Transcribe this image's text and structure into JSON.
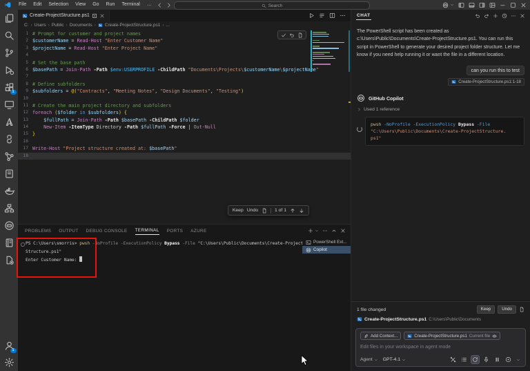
{
  "window": {
    "menus": [
      "File",
      "Edit",
      "Selection",
      "View",
      "Go",
      "Run",
      "Terminal"
    ],
    "menu_overflow": "…",
    "nav_icons": [
      "arrow-left",
      "arrow-right"
    ],
    "search_placeholder": "Search",
    "right_icons": [
      "copilot",
      "chevron-down",
      "layout-sidebar-left",
      "layout-panel",
      "layout-sidebar-right",
      "layout-custom",
      "minimize",
      "maximize",
      "close"
    ]
  },
  "activity_bar": {
    "items": [
      {
        "name": "explorer"
      },
      {
        "name": "search"
      },
      {
        "name": "source-control"
      },
      {
        "name": "run-and-debug"
      },
      {
        "name": "extensions",
        "badge": "1"
      },
      {
        "name": "remote-explorer"
      },
      {
        "name": "azure"
      },
      {
        "name": "python"
      },
      {
        "name": "share"
      },
      {
        "name": "notebook-edit"
      },
      {
        "name": "docker"
      },
      {
        "name": "hierarchy"
      },
      {
        "name": "copilot"
      },
      {
        "name": "notebook"
      },
      {
        "name": "file-settings"
      }
    ],
    "bottom": [
      {
        "name": "accounts",
        "badge": "1"
      },
      {
        "name": "settings"
      }
    ]
  },
  "editor": {
    "tab": {
      "label": "Create-ProjectStructure.ps1"
    },
    "actions": [
      "play",
      "run-menu",
      "split-editor",
      "more"
    ],
    "breadcrumb": [
      "C:",
      "Users",
      "Public",
      "Documents",
      "Create-ProjectStructure.ps1",
      "..."
    ],
    "inline_toolbar": [
      "check",
      "undo",
      "doc"
    ],
    "review_widget": {
      "keep": "Keep",
      "undo": "Undo",
      "counter": "1 of 1",
      "nav_icons": [
        "arrow-up",
        "arrow-down"
      ]
    },
    "code_lines": [
      {
        "n": "1",
        "t": [
          [
            "c",
            "# Prompt for customer and project names"
          ]
        ]
      },
      {
        "n": "2",
        "t": [
          [
            "v",
            "$customerName"
          ],
          [
            "o",
            " = "
          ],
          [
            "f",
            "Read-Host"
          ],
          [
            "o",
            " "
          ],
          [
            "s",
            "\"Enter Customer Name\""
          ]
        ]
      },
      {
        "n": "3",
        "t": [
          [
            "v",
            "$projectName"
          ],
          [
            "o",
            " = "
          ],
          [
            "f",
            "Read-Host"
          ],
          [
            "o",
            " "
          ],
          [
            "s",
            "\"Enter Project Name\""
          ]
        ]
      },
      {
        "n": "4",
        "t": []
      },
      {
        "n": "5",
        "t": [
          [
            "c",
            "# Set the base path"
          ]
        ]
      },
      {
        "n": "6",
        "t": [
          [
            "v",
            "$basePath"
          ],
          [
            "o",
            " = "
          ],
          [
            "f",
            "Join-Path"
          ],
          [
            "o",
            " "
          ],
          [
            "p",
            "-Path"
          ],
          [
            "o",
            " "
          ],
          [
            "e",
            "$env:USERPROFILE"
          ],
          [
            "o",
            " "
          ],
          [
            "p",
            "-ChildPath"
          ],
          [
            "o",
            " "
          ],
          [
            "s",
            "\"Documents\\Projects\\"
          ],
          [
            "sv",
            "$customerName"
          ],
          [
            "s",
            "\\"
          ],
          [
            "sv",
            "$projectName"
          ],
          [
            "s",
            "\""
          ]
        ]
      },
      {
        "n": "7",
        "t": []
      },
      {
        "n": "8",
        "t": [
          [
            "c",
            "# Define subfolders"
          ]
        ]
      },
      {
        "n": "9",
        "t": [
          [
            "v",
            "$subfolders"
          ],
          [
            "o",
            " = "
          ],
          [
            "g",
            "@("
          ],
          [
            "s",
            "\"Contracts\""
          ],
          [
            "o",
            ", "
          ],
          [
            "s",
            "\"Meeting Notes\""
          ],
          [
            "o",
            ", "
          ],
          [
            "s",
            "\"Design Documents\""
          ],
          [
            "o",
            ", "
          ],
          [
            "s",
            "\"Testing\""
          ],
          [
            "g",
            ")"
          ]
        ]
      },
      {
        "n": "10",
        "t": []
      },
      {
        "n": "11",
        "t": [
          [
            "c",
            "# Create the main project directory and subfolders"
          ]
        ]
      },
      {
        "n": "12",
        "t": [
          [
            "k",
            "foreach"
          ],
          [
            "o",
            " "
          ],
          [
            "g",
            "("
          ],
          [
            "v",
            "$folder"
          ],
          [
            "o",
            " "
          ],
          [
            "kb",
            "in"
          ],
          [
            "o",
            " "
          ],
          [
            "v",
            "$subfolders"
          ],
          [
            "g",
            ")"
          ],
          [
            "o",
            " "
          ],
          [
            "g",
            "{"
          ]
        ]
      },
      {
        "n": "13",
        "t": [
          [
            "o",
            "    "
          ],
          [
            "v",
            "$fullPath"
          ],
          [
            "o",
            " = "
          ],
          [
            "f",
            "Join-Path"
          ],
          [
            "o",
            " "
          ],
          [
            "p",
            "-Path"
          ],
          [
            "o",
            " "
          ],
          [
            "v",
            "$basePath"
          ],
          [
            "o",
            " "
          ],
          [
            "p",
            "-ChildPath"
          ],
          [
            "o",
            " "
          ],
          [
            "v",
            "$folder"
          ]
        ]
      },
      {
        "n": "14",
        "t": [
          [
            "o",
            "    "
          ],
          [
            "f",
            "New-Item"
          ],
          [
            "o",
            " "
          ],
          [
            "p",
            "-ItemType"
          ],
          [
            "o",
            " "
          ],
          [
            "t",
            "Directory"
          ],
          [
            "o",
            " "
          ],
          [
            "p",
            "-Path"
          ],
          [
            "o",
            " "
          ],
          [
            "v",
            "$fullPath"
          ],
          [
            "o",
            " "
          ],
          [
            "p",
            "-Force"
          ],
          [
            "o",
            " | "
          ],
          [
            "f",
            "Out-Null"
          ]
        ]
      },
      {
        "n": "15",
        "t": [
          [
            "g",
            "}"
          ]
        ]
      },
      {
        "n": "16",
        "t": []
      },
      {
        "n": "17",
        "t": [
          [
            "f",
            "Write-Host"
          ],
          [
            "o",
            " "
          ],
          [
            "s",
            "\"Project structure created at: "
          ],
          [
            "sv",
            "$basePath"
          ],
          [
            "s",
            "\""
          ]
        ]
      },
      {
        "n": "18",
        "t": [],
        "current": true
      }
    ]
  },
  "panel": {
    "tabs": [
      "PROBLEMS",
      "OUTPUT",
      "DEBUG CONSOLE",
      "TERMINAL",
      "PORTS",
      "AZURE"
    ],
    "active_tab": "TERMINAL",
    "actions": [
      "plus",
      "chevron-down",
      "more",
      "chevron-up",
      "close"
    ],
    "terminal": {
      "lines": [
        {
          "deco": true,
          "t": [
            [
              "tp",
              "PS C:\\Users\\smorris> "
            ],
            [
              "ty",
              "pwsh"
            ],
            [
              "td",
              " -NoProfile -ExecutionPolicy "
            ],
            [
              "tb",
              "Bypass"
            ],
            [
              "td",
              " -File "
            ],
            [
              "tp",
              "\"C:\\Users\\Public\\Documents\\Create-Project"
            ]
          ]
        },
        {
          "t": [
            [
              "tp",
              "Structure.ps1\""
            ]
          ]
        },
        {
          "t": [
            [
              "tp",
              "Enter Customer Name: "
            ]
          ],
          "cursor": true
        }
      ],
      "list": [
        {
          "label": "PowerShell Ext...",
          "icon": "terminal"
        },
        {
          "label": "Copilot",
          "icon": "copilot",
          "selected": true
        }
      ]
    }
  },
  "chat": {
    "title": "CHAT",
    "header_icons": [
      "undo",
      "redo",
      "plus",
      "history",
      "more",
      "close"
    ],
    "assistant_text": "The PowerShell script has been created as c:\\Users\\Public\\Documents\\Create-ProjectStructure.ps1. You can run this script in PowerShell to generate your desired project folder structure. Let me know if you need help running it or want the file in a different location.",
    "user_message": "can you run this to test",
    "user_reference": "Create-ProjectStructure.ps1:1-18",
    "provider": "GitHub Copilot",
    "references_toggle": "Used 1 reference",
    "code_block": [
      [
        [
          "y",
          "pwsh"
        ],
        [
          "b",
          " -NoProfile"
        ],
        [
          "b",
          " -ExecutionPolicy"
        ],
        [
          "w",
          " Bypass"
        ],
        [
          "b",
          " -File"
        ]
      ],
      [
        [
          "o",
          "\"C:\\Users\\Public\\Documents\\Create-ProjectStructure."
        ]
      ],
      [
        [
          "o",
          "ps1\""
        ]
      ]
    ],
    "changes": {
      "summary": "1 file changed",
      "keep": "Keep",
      "undo": "Undo",
      "file": "Create-ProjectStructure.ps1",
      "path": "C:\\Users\\Public\\Documents"
    },
    "input": {
      "add_context": "Add Context...",
      "attached_file": "Create-ProjectStructure.ps1",
      "attached_file_suffix": "Current file",
      "placeholder": "Edit files in your workspace in agent mode",
      "mode": "Agent",
      "model": "GPT-4.1",
      "icons": [
        "tools",
        "list",
        "sync",
        "mic",
        "pause",
        "send",
        "chevron-down"
      ],
      "active_icon": "sync"
    }
  }
}
